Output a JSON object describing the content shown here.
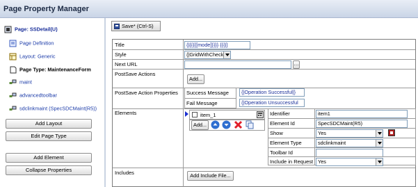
{
  "header": {
    "title": "Page Property Manager"
  },
  "tree": {
    "root": "Page: SSDetail(U)",
    "items": [
      "Page Definition",
      "Layout: Generic",
      "Page Type: MaintenanceForm",
      "maint",
      "advancedtoolbar",
      "sdclinkmaint (SpecSDCMaint(R5))"
    ]
  },
  "left_buttons": [
    "Add Layout",
    "Edit Page Type",
    "Add Element",
    "Collapse Properties"
  ],
  "toolbar": {
    "save_label": "Save* (Ctrl-S)"
  },
  "form": {
    "title_label": "Title",
    "title_value": "{|{{{{[mode]}}}} {{{{|",
    "style_label": "Style",
    "style_value": "{|GridWithCheckBox|",
    "next_url_label": "Next URL",
    "next_url_value": "",
    "postsave_actions_label": "PostSave Actions",
    "add_label": "Add...",
    "postsave_props_label": "PostSave Action Properties",
    "success_label": "Success Message",
    "success_value": "{|Operation Successful|}",
    "fail_label": "Fail Message",
    "fail_value": "{|Operation Unsuccessful",
    "elements_label": "Elements",
    "element_item": "item_1",
    "includes_label": "Includes",
    "add_include_label": "Add Include File..."
  },
  "element_props": {
    "identifier_label": "Identifier",
    "identifier_value": "item1",
    "element_id_label": "Element Id",
    "element_id_value": "SpecSDCMaint(R5)",
    "show_label": "Show",
    "show_value": "Yes",
    "element_type_label": "Element Type",
    "element_type_value": "sdclinkmaint",
    "toolbar_id_label": "Toolbar Id",
    "toolbar_id_value": "",
    "include_label": "Include in Request",
    "include_value": "Yes"
  },
  "colors": {
    "accent": "#1a2f9a",
    "header_bg": "#c9d4e6"
  }
}
